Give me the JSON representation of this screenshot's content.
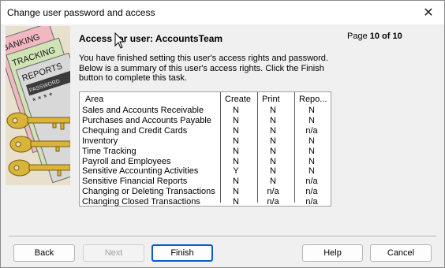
{
  "window": {
    "title": "Change user password and access",
    "close_glyph": "✕"
  },
  "art": {
    "lines": [
      "BANKING",
      "TRACKING",
      "REPORTS",
      "PASSWORD"
    ],
    "password_mask": "* * * *"
  },
  "header": {
    "heading": "Access for user: AccountsTeam",
    "page_label": "Page",
    "page_value": "10 of 10"
  },
  "description": "You have finished setting this user's access rights and password. Below is a summary of this user's access rights.  Click the Finish button to complete this task.",
  "summary": {
    "columns": [
      "Area",
      "Create",
      "Print",
      "Repo..."
    ],
    "rows": [
      [
        "Sales and Accounts Receivable",
        "N",
        "N",
        "N"
      ],
      [
        "Purchases and Accounts Payable",
        "N",
        "N",
        "N"
      ],
      [
        "Chequing and Credit Cards",
        "N",
        "N",
        "n/a"
      ],
      [
        "Inventory",
        "N",
        "N",
        "N"
      ],
      [
        "Time Tracking",
        "N",
        "N",
        "N"
      ],
      [
        "Payroll and Employees",
        "N",
        "N",
        "N"
      ],
      [
        "Sensitive Accounting Activities",
        "Y",
        "N",
        "N"
      ],
      [
        "Sensitive Financial Reports",
        "N",
        "N",
        "n/a"
      ],
      [
        "Changing or Deleting Transactions",
        "N",
        "n/a",
        "n/a"
      ],
      [
        "Changing Closed Transactions",
        "N",
        "n/a",
        "n/a"
      ]
    ]
  },
  "buttons": {
    "back": "Back",
    "next": "Next",
    "finish": "Finish",
    "help": "Help",
    "cancel": "Cancel"
  },
  "colors": {
    "default_button_border": "#0b5cc9",
    "window_bg": "#f0f0f0",
    "titlebar_bg": "#ffffff"
  }
}
